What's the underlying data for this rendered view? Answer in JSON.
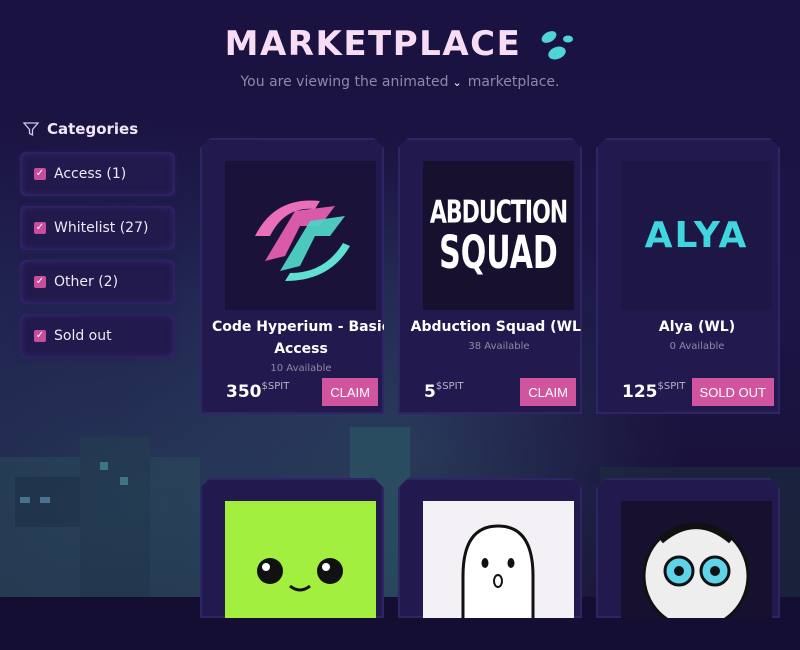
{
  "header": {
    "title": "MARKETPLACE",
    "subtitle_prefix": "You are viewing the animated",
    "subtitle_suffix": "marketplace."
  },
  "sidebar": {
    "heading": "Categories",
    "items": [
      {
        "label": "Access (1)"
      },
      {
        "label": "Whitelist (27)"
      },
      {
        "label": "Other (2)"
      },
      {
        "label": "Sold out"
      }
    ]
  },
  "cards": [
    {
      "name": "Code Hyperium - Basic Access",
      "available": "10 Available",
      "price": "350",
      "currency": "$SPIT",
      "action": "CLAIM"
    },
    {
      "name": "Abduction Squad (WL)",
      "available": "38 Available",
      "price": "5",
      "currency": "$SPIT",
      "action": "CLAIM",
      "logo_line1": "ABDUCTION",
      "logo_line2": "SQUAD"
    },
    {
      "name": "Alya (WL)",
      "available": "0 Available",
      "price": "125",
      "currency": "$SPIT",
      "action": "SOLD OUT",
      "logo": "ALYA"
    }
  ],
  "colors": {
    "accent": "#d1559e",
    "title": "#f7dcf4",
    "background": "#150e33",
    "card": "#221a4e"
  }
}
